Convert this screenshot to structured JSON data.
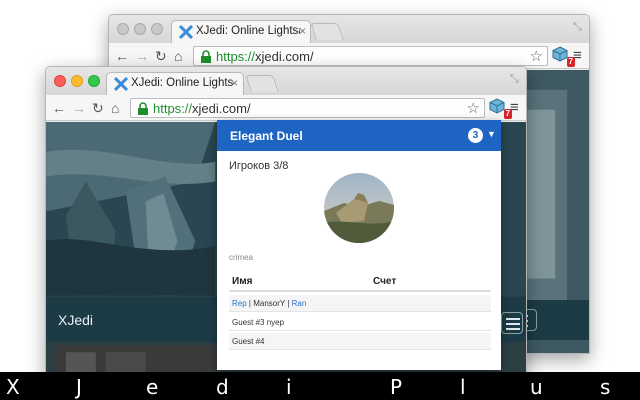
{
  "back_window": {
    "tab_title": "XJedi: Online Lightsaber Figh",
    "url_scheme": "https://",
    "url_rest": "xjedi.com/",
    "extension_badge": "7"
  },
  "front_window": {
    "tab_title": "XJedi: Online Lightsaber Figh",
    "url_scheme": "https://",
    "url_rest": "xjedi.com/",
    "extension_badge": "7"
  },
  "site": {
    "brand": "XJedi"
  },
  "popup": {
    "game_name": "Elegant Duel",
    "game_count": "3",
    "players_label": "Игроков 3/8",
    "map_name": "crimea",
    "col_name": "Имя",
    "col_score": "Счет",
    "rows": [
      {
        "parts": [
          "Rep",
          " | ",
          "MansorY",
          " | ",
          "Ran"
        ],
        "links": [
          true,
          false,
          false,
          false,
          true
        ]
      },
      {
        "parts": [
          "Guest #3 nyep"
        ],
        "links": [
          false
        ]
      },
      {
        "parts": [
          "Guest #4"
        ],
        "links": [
          false
        ]
      }
    ]
  },
  "colors": {
    "popup_header": "#1e64c2",
    "badge_red": "#d8232a",
    "secure_green": "#1f8f2d",
    "site_bar": "#1d3b45"
  },
  "footer": {
    "letters": [
      "X",
      "J",
      "e",
      "d",
      "i",
      "P",
      "l",
      "u",
      "s"
    ]
  }
}
